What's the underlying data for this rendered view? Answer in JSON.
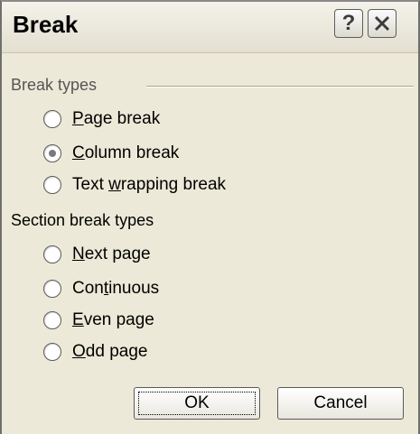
{
  "window": {
    "title": "Break",
    "help_glyph": "?",
    "help_icon": "question-mark-icon",
    "close_icon": "close-x-icon"
  },
  "break_types": {
    "label": "Break types",
    "options": [
      {
        "pre": "",
        "key": "P",
        "post": "age break",
        "selected": false
      },
      {
        "pre": "",
        "key": "C",
        "post": "olumn break",
        "selected": true
      },
      {
        "pre": "Text ",
        "key": "w",
        "post": "rapping break",
        "selected": false
      }
    ]
  },
  "section_break_types": {
    "label": "Section break types",
    "options": [
      {
        "pre": "",
        "key": "N",
        "post": "ext page",
        "selected": false
      },
      {
        "pre": "Con",
        "key": "t",
        "post": "inuous",
        "selected": false
      },
      {
        "pre": "",
        "key": "E",
        "post": "ven page",
        "selected": false
      },
      {
        "pre": "",
        "key": "O",
        "post": "dd page",
        "selected": false
      }
    ]
  },
  "buttons": {
    "ok": "OK",
    "cancel": "Cancel"
  }
}
